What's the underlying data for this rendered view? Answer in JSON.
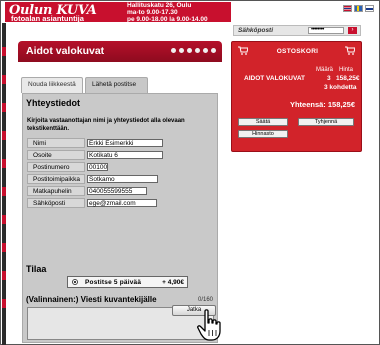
{
  "header": {
    "logo_word_script": "Oulun",
    "logo_word_main": "KUVA",
    "logo_subtitle": "fotoalan asiantuntija",
    "address_line": "Hallituskatu 26, Oulu",
    "hours_weekdays": "ma-to 9.00-17.30",
    "hours_friday": "pe 9.00-18.00 la 9.00-14.00",
    "flags": [
      "english-flag-icon",
      "swedish-flag-icon",
      "finnish-flag-icon"
    ]
  },
  "login": {
    "email_label": "Sähköposti",
    "password_value": "••••••••"
  },
  "main": {
    "title": "Aidot valokuvat",
    "tabs": [
      {
        "label": "Nouda liikkeestä"
      },
      {
        "label": "Lähetä postitse"
      }
    ]
  },
  "form": {
    "contact_heading": "Yhteystiedot",
    "contact_intro": "Kirjoita vastaanottajan nimi ja yhteystiedot alla olevaan tekstikenttään.",
    "fields": [
      {
        "label": "Nimi",
        "value": "Erkki Esimerkki"
      },
      {
        "label": "Osoite",
        "value": "Kotikatu 6"
      },
      {
        "label": "Postinumero",
        "value": "00100"
      },
      {
        "label": "Postitoimipaikka",
        "value": "Sotkamo"
      },
      {
        "label": "Matkapuhelin",
        "value": "040055599555"
      },
      {
        "label": "Sähköposti",
        "value": "ege@zmail.com"
      }
    ],
    "order_heading": "Tilaa",
    "shipping_option": "Postitse 5 päivää",
    "shipping_price": "+ 4,90€",
    "message_heading": "(Valinnainen:) Viesti kuvantekijälle",
    "message_counter": "0/160",
    "message_value": "",
    "next_button": "Jatka"
  },
  "cart": {
    "title": "OSTOSKORI",
    "col_qty": "Määrä",
    "col_price": "Hinta",
    "item_name": "AIDOT VALOKUVAT",
    "item_qty": "3",
    "item_price": "158,25€",
    "item_count": "3 kohdetta",
    "total": "Yhteensä: 158,25€",
    "edit_button": "Säätä",
    "empty_button": "Tyhjennä",
    "pricing_button": "Hinnasto"
  },
  "colors": {
    "brand_red": "#c8102e",
    "panel_gray": "#c9c9c9"
  }
}
